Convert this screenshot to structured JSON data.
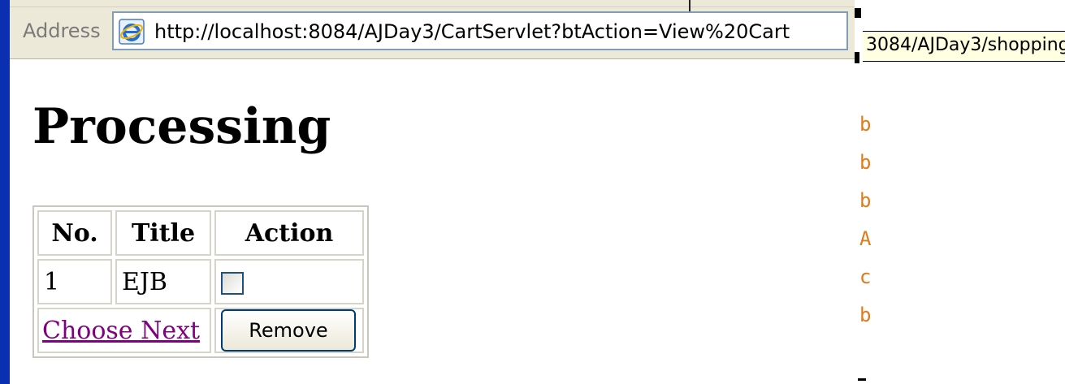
{
  "browser": {
    "address_label": "Address",
    "address_url": "http://localhost:8084/AJDay3/CartServlet?btAction=View%20Cart",
    "side_tooltip": "3084/AJDay3/shopping",
    "side_fragments": [
      "b",
      "b",
      "b",
      "A",
      "c",
      "b"
    ]
  },
  "page": {
    "heading": "Processing",
    "table": {
      "headers": [
        "No.",
        "Title",
        "Action"
      ],
      "rows": [
        {
          "no": "1",
          "title": "EJB",
          "checked": false
        }
      ],
      "link_label": "Choose Next",
      "remove_label": "Remove"
    }
  },
  "colors": {
    "link": "#800080",
    "window_border": "#0a2fb0",
    "side_text": "#e07b1a"
  }
}
